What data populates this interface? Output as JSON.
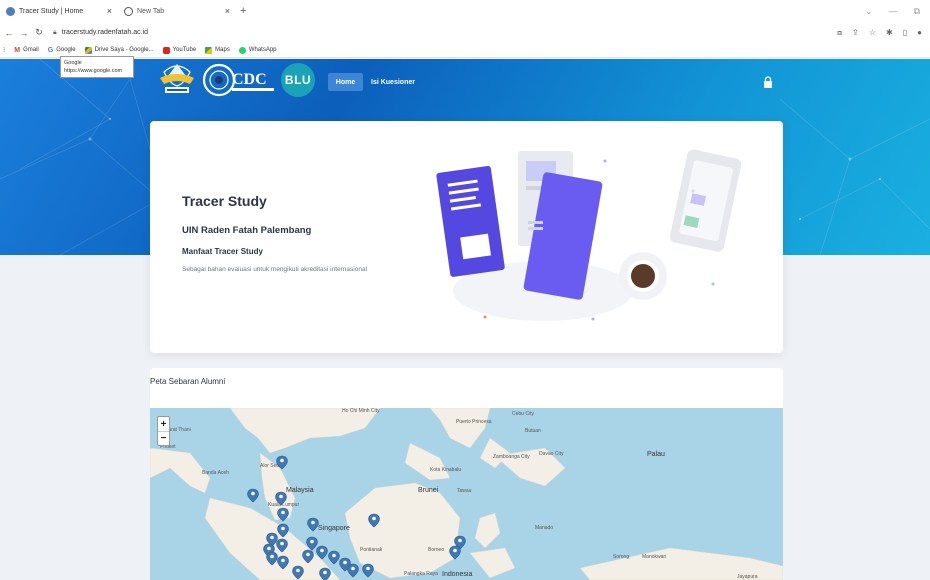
{
  "browser": {
    "tabs": [
      {
        "title": "Tracer Study | Home",
        "active": true
      },
      {
        "title": "New Tab",
        "active": false
      }
    ],
    "new_tab_symbol": "+",
    "close_symbol": "×",
    "address": "tracerstudy.radenfatah.ac.id",
    "bookmarks": [
      "Gmail",
      "Google",
      "Drive Saya - Google...",
      "YouTube",
      "Maps",
      "WhatsApp"
    ],
    "tooltip": {
      "title": "Google",
      "url": "https://www.google.com"
    }
  },
  "nav": {
    "blu_logo": "BLU",
    "home": "Home",
    "kuesioner": "Isi Kuesioner",
    "icons": [
      "lock-icon"
    ]
  },
  "hero": {
    "title": "Tracer Study",
    "subtitle": "UIN Raden Fatah Palembang",
    "section": "Manfaat Tracer Study",
    "description": "Sebagai bahan evaluasi untuk mengikuti akreditasi internasional"
  },
  "map": {
    "title": "Peta Sebaran Alumni",
    "zoom_in": "+",
    "zoom_out": "−",
    "labels": [
      {
        "text": "Ho Chi Minh City"
      },
      {
        "text": "Cebu City"
      },
      {
        "text": "Puerto Princesa"
      },
      {
        "text": "Butuan"
      },
      {
        "text": "Surat Thani"
      },
      {
        "text": "Phuket"
      },
      {
        "text": "Zamboanga City"
      },
      {
        "text": "Davao City"
      },
      {
        "text": "Palau"
      },
      {
        "text": "Alor Setar"
      },
      {
        "text": "Kota Kinabalu"
      },
      {
        "text": "Banda Aceh"
      },
      {
        "text": "Malaysia"
      },
      {
        "text": "Brunei"
      },
      {
        "text": "Tawau"
      },
      {
        "text": "Kuala Lumpur"
      },
      {
        "text": "Singapore"
      },
      {
        "text": "Manado"
      },
      {
        "text": "Pontianak"
      },
      {
        "text": "Borneo"
      },
      {
        "text": "Sorong"
      },
      {
        "text": "Manokwari"
      },
      {
        "text": "Palangka Raya"
      },
      {
        "text": "Indonesia"
      },
      {
        "text": "Jayapura"
      }
    ]
  }
}
